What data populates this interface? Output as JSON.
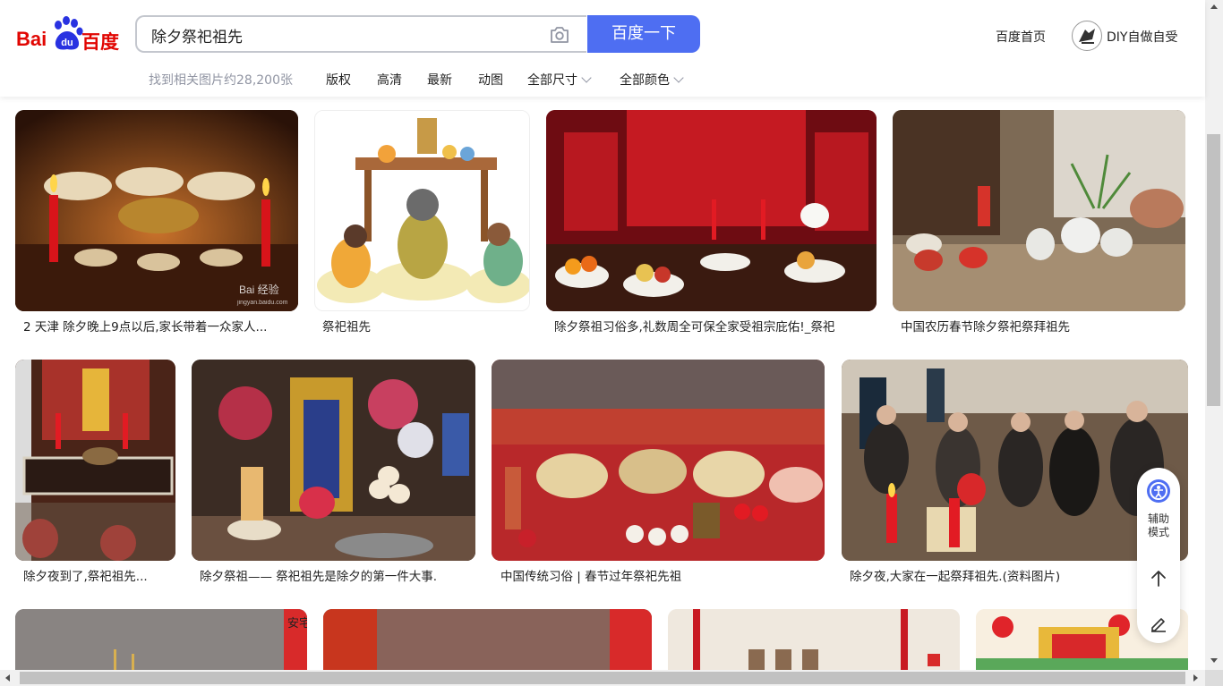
{
  "header": {
    "logo_text_latin": "Bai",
    "logo_text_paw": "du",
    "logo_text_cn": "百度",
    "search_query": "除夕祭祀祖先",
    "search_button": "百度一下",
    "home_link": "百度首页",
    "username": "DIY自做自受"
  },
  "filters": {
    "result_count": "找到相关图片约28,200张",
    "items": [
      "版权",
      "高清",
      "最新",
      "动图",
      "全部尺寸",
      "全部颜色"
    ]
  },
  "results": {
    "row1": [
      {
        "caption": "2 天津 除夕晚上9点以后,家长带着一众家人..."
      },
      {
        "caption": "祭祀祖先"
      },
      {
        "caption": "除夕祭祖习俗多,礼数周全可保全家受祖宗庇佑!_祭祀"
      },
      {
        "caption": "中国农历春节除夕祭祀祭拜祖先"
      }
    ],
    "row2": [
      {
        "caption": "除夕夜到了,祭祀祖先..."
      },
      {
        "caption": "除夕祭祖—— 祭祀祖先是除夕的第一件大事."
      },
      {
        "caption": "中国传统习俗 | 春节过年祭祀先祖"
      },
      {
        "caption": "除夕夜,大家在一起祭拜祖先.(资料图片)"
      }
    ],
    "watermark": "Bai 经验",
    "watermark_sub": "jingyan.baidu.com",
    "banner_text": "安宅"
  },
  "side_panel": {
    "assist_label_1": "辅助",
    "assist_label_2": "模式"
  },
  "colors": {
    "brand_blue": "#4e6ef2",
    "brand_red": "#e10602"
  }
}
